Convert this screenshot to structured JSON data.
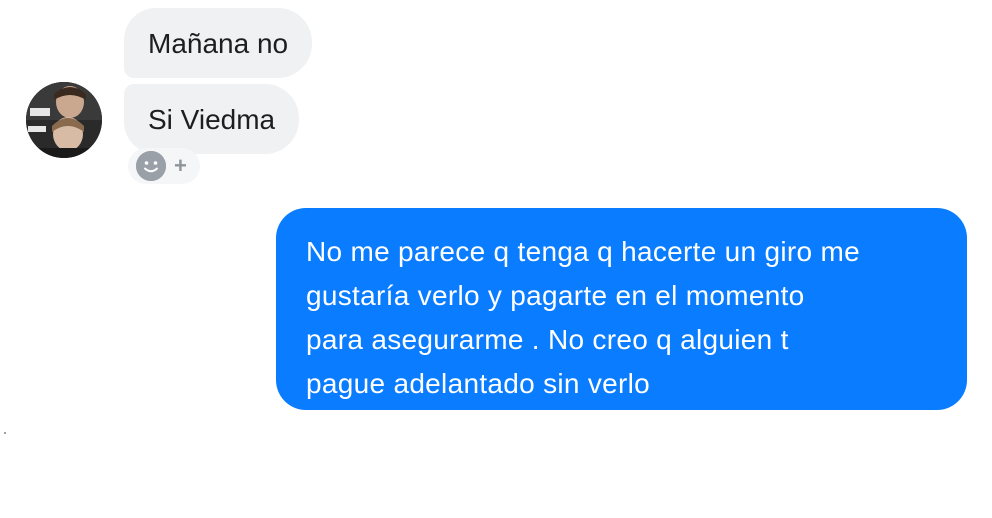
{
  "conversation": {
    "incoming": [
      {
        "text": "Mañana no"
      },
      {
        "text": "Si Viedma"
      }
    ],
    "outgoing": {
      "lines": [
        "No me parece q tenga q hacerte un giro me",
        "gustaría verlo y pagarte en el momento",
        "para asegurarme . No creo q alguien t",
        "pague adelantado sin verlo"
      ]
    },
    "reaction": {
      "icon": "smiley-icon",
      "plus_label": "+"
    }
  },
  "colors": {
    "incoming_bubble": "#f0f1f3",
    "outgoing_bubble": "#0a7cff",
    "text_dark": "#1c1e21",
    "text_light": "#ffffff"
  }
}
